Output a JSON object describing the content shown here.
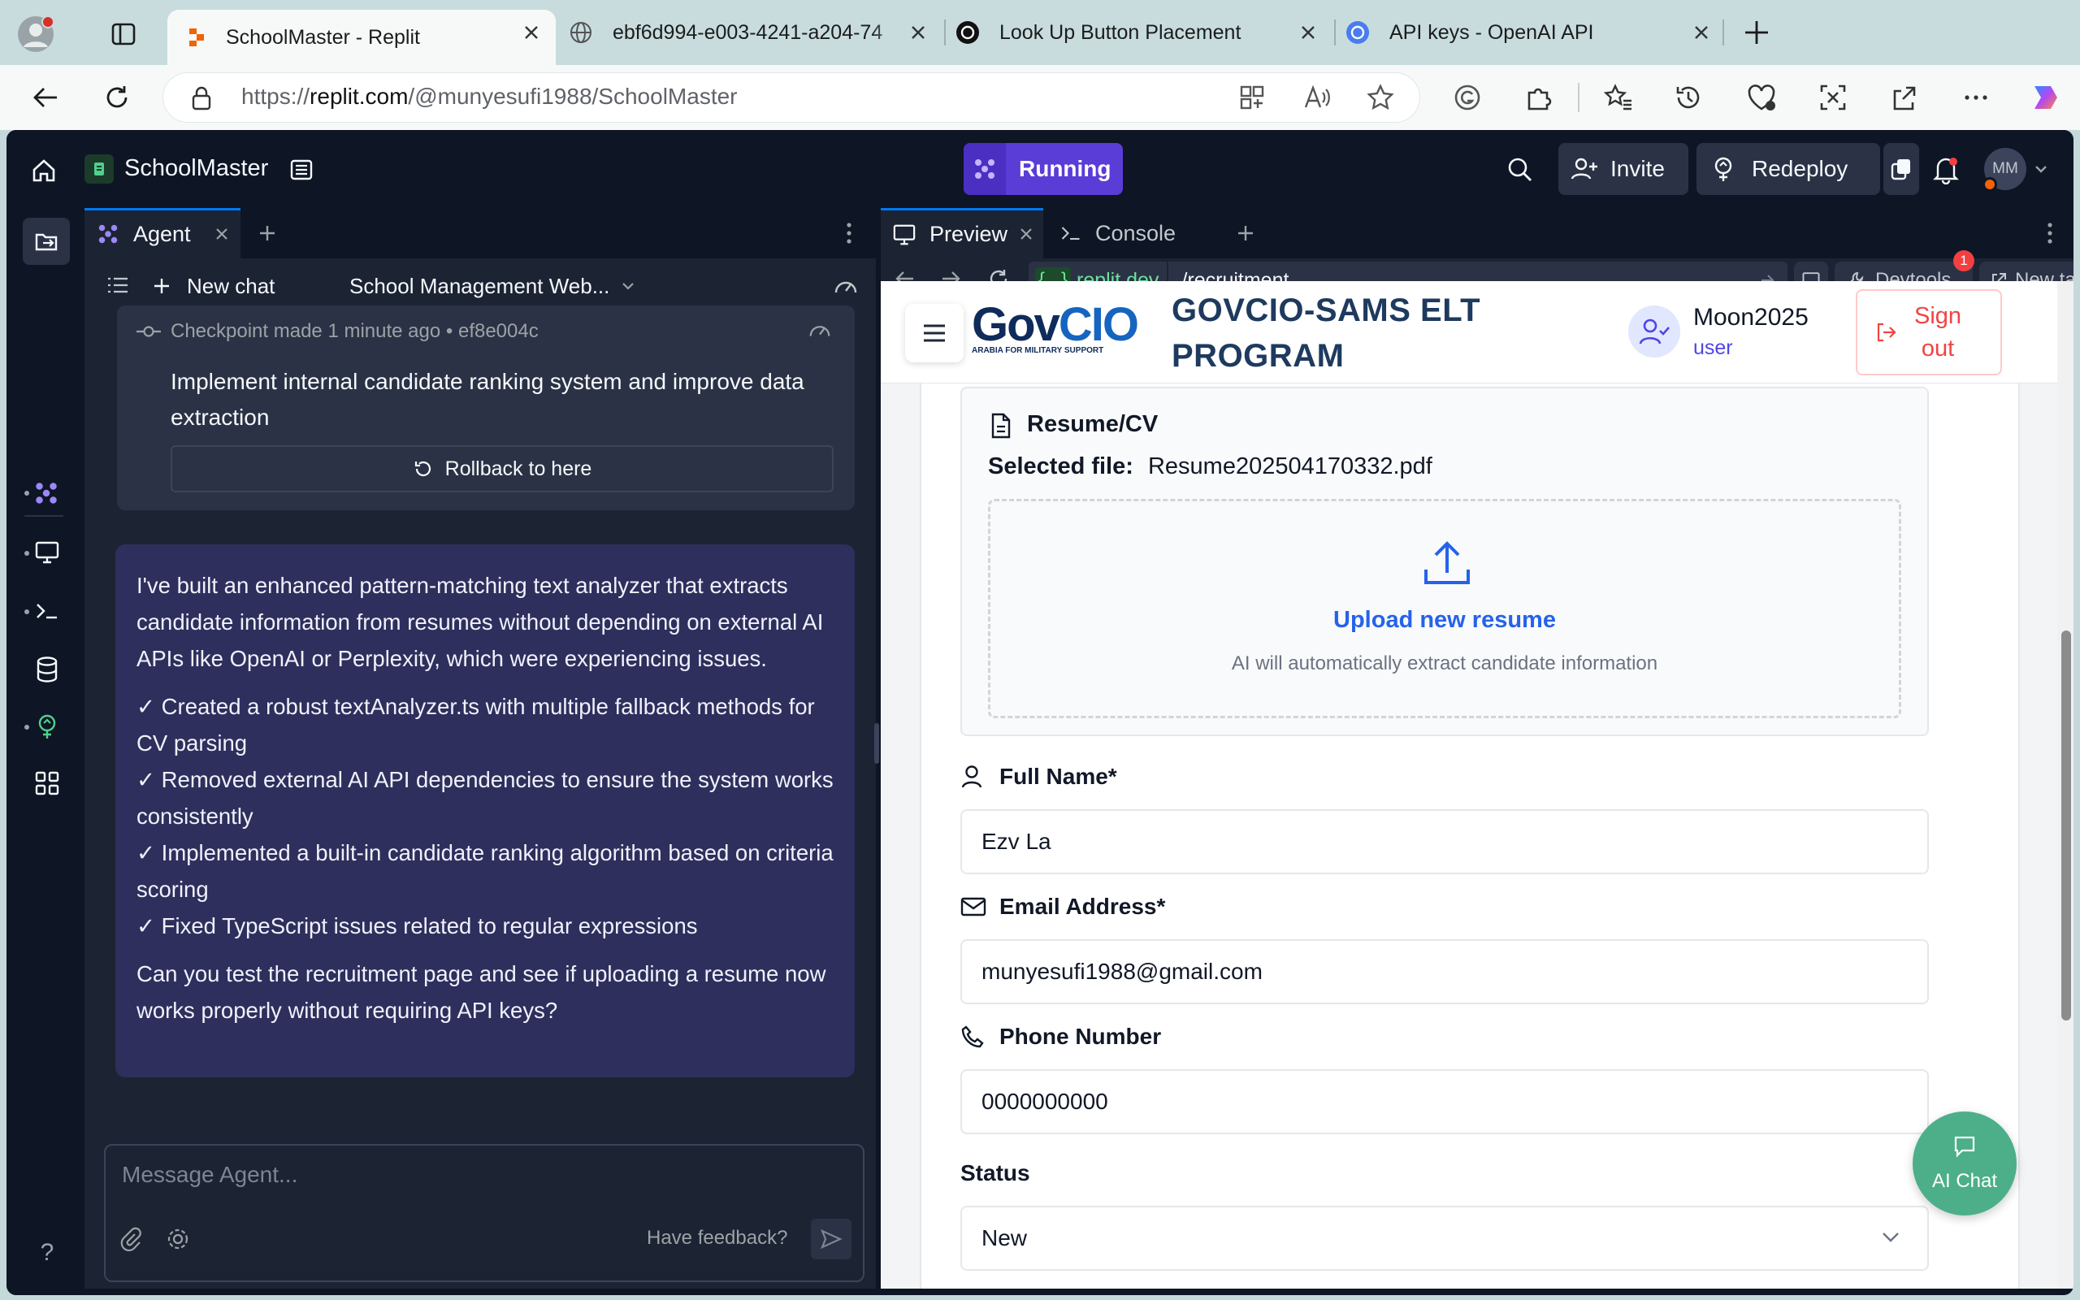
{
  "browser": {
    "tabs": [
      {
        "title": "SchoolMaster - Replit",
        "active": true
      },
      {
        "title": "ebf6d994-e003-4241-a204-74"
      },
      {
        "title": "Look Up Button Placement"
      },
      {
        "title": "API keys - OpenAI API"
      }
    ],
    "url_prefix": "https://",
    "url_host": "replit.com",
    "url_path": "/@munyesufi1988/SchoolMaster"
  },
  "replit": {
    "project_name": "SchoolMaster",
    "run_status": "Running",
    "invite_label": "Invite",
    "redeploy_label": "Redeploy",
    "avatar_initials": "MM",
    "agent": {
      "tab_label": "Agent",
      "new_chat_label": "New chat",
      "chat_title": "School Management Web...",
      "checkpoint": {
        "label": "Checkpoint made",
        "time": "1 minute ago",
        "separator": "•",
        "hash": "ef8e004c",
        "description": "Implement internal candidate ranking system and improve data extraction",
        "rollback_label": "Rollback to here"
      },
      "message": {
        "intro": "I've built an enhanced pattern-matching text analyzer that extracts candidate information from resumes without depending on external AI APIs like OpenAI or Perplexity, which were experiencing issues.",
        "bullets": [
          "✓ Created a robust textAnalyzer.ts with multiple fallback methods for CV parsing",
          "✓ Removed external AI API dependencies to ensure the system works consistently",
          "✓ Implemented a built-in candidate ranking algorithm based on criteria scoring",
          "✓ Fixed TypeScript issues related to regular expressions"
        ],
        "question": "Can you test the recruitment page and see if uploading a resume now works properly without requiring API keys?"
      },
      "composer_placeholder": "Message Agent...",
      "feedback_label": "Have feedback?"
    },
    "preview": {
      "tab_preview": "Preview",
      "tab_console": "Console",
      "url_badge": "{...}",
      "url_domain": ".replit.dev",
      "url_path": "/recruitment",
      "devtools_label": "Devtools",
      "devtools_badge": "1",
      "new_tab_label": "New tab"
    }
  },
  "app": {
    "logo_text": "GovCIO",
    "logo_tagline": "ARABIA FOR MILITARY SUPPORT",
    "title_line1": "GOVCIO-SAMS ELT",
    "title_line2": "PROGRAM",
    "user_name": "Moon2025",
    "user_role": "user",
    "signout_line1": "Sign",
    "signout_line2": "out",
    "resume": {
      "heading": "Resume/CV",
      "selected_label": "Selected file:",
      "selected_file": "Resume202504170332.pdf",
      "upload_label": "Upload new resume",
      "upload_hint": "AI will automatically extract candidate information"
    },
    "fields": {
      "full_name_label": "Full Name*",
      "full_name_value": "Ezv La",
      "email_label": "Email Address*",
      "email_value": "munyesufi1988@gmail.com",
      "phone_label": "Phone Number",
      "phone_value": "0000000000",
      "status_label": "Status",
      "status_value": "New"
    },
    "ai_chat_label": "AI Chat"
  }
}
